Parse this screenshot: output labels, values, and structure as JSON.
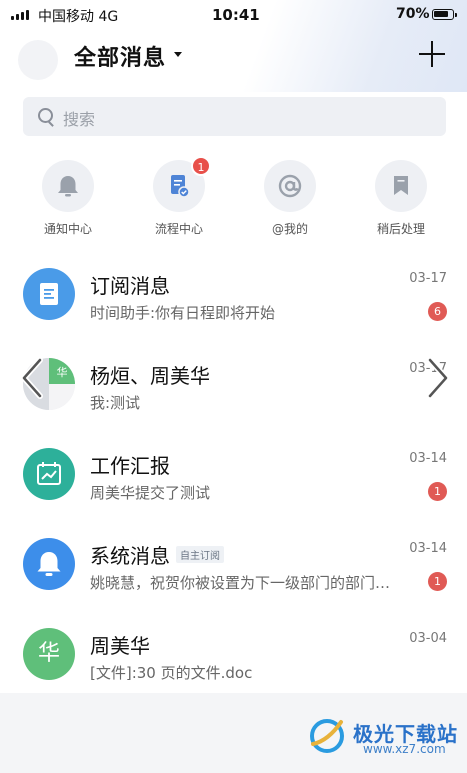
{
  "status": {
    "carrier": "中国移动 4G",
    "time": "10:41",
    "battery": "70%",
    "battery_level": 0.7
  },
  "header": {
    "title": "全部消息"
  },
  "search": {
    "placeholder": "搜索"
  },
  "quick_actions": [
    {
      "label": "通知中心",
      "icon": "bell-icon"
    },
    {
      "label": "流程中心",
      "icon": "workflow-icon",
      "badge": "1"
    },
    {
      "label": "@我的",
      "icon": "at-icon"
    },
    {
      "label": "稍后处理",
      "icon": "bookmark-icon"
    }
  ],
  "conversations": [
    {
      "name": "订阅消息",
      "preview": "时间助手:你有日程即将开始",
      "date": "03-17",
      "count": "6",
      "icon": "document-icon",
      "color": "#4a9be8"
    },
    {
      "name": "杨烜、周美华",
      "preview": "我:测试",
      "date": "03-17",
      "icon": "group-avatar"
    },
    {
      "name": "工作汇报",
      "preview": "周美华提交了测试",
      "date": "03-14",
      "count": "1",
      "icon": "report-chart-icon",
      "color": "#2db09a"
    },
    {
      "name": "系统消息",
      "tag": "自主订阅",
      "preview": "姚晓慧，祝贺你被设置为下一级部门的部门…",
      "date": "03-14",
      "count": "1",
      "icon": "bell-icon",
      "color": "#3d8eea"
    },
    {
      "name": "周美华",
      "avatar_text": "华",
      "preview": "[文件]:30 页的文件.doc",
      "date": "03-04",
      "color": "#5fbf7a"
    }
  ],
  "watermark": {
    "name": "极光下载站",
    "url": "www.xz7.com"
  }
}
